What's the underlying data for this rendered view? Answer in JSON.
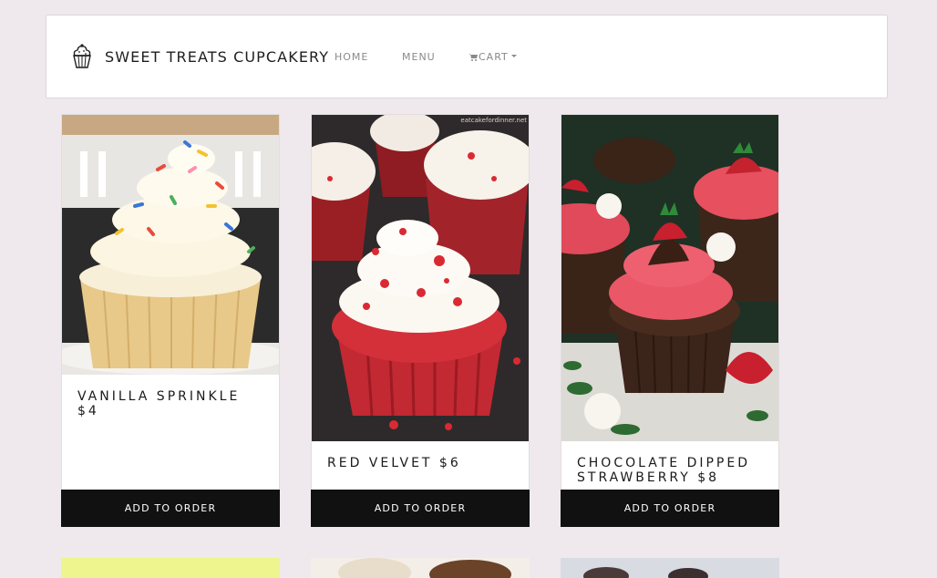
{
  "brand": {
    "name": "SWEET TREATS CUPCAKERY",
    "icon": "cupcake-logo-icon"
  },
  "nav": {
    "home": "HOME",
    "menu": "MENU",
    "cart": "CART",
    "cart_icon": "cart-icon"
  },
  "products": [
    {
      "title": "VANILLA SPRINKLE $4",
      "button": "ADD TO ORDER",
      "image_watermark": ""
    },
    {
      "title": "RED VELVET $6",
      "button": "ADD TO ORDER",
      "image_watermark": "eatcakefordinner.net"
    },
    {
      "title": "CHOCOLATE DIPPED STRAWBERRY $8",
      "button": "ADD TO ORDER",
      "image_watermark": ""
    }
  ],
  "colors": {
    "page_bg": "#efe9ed",
    "button_bg": "#111111",
    "button_text": "#ffffff"
  }
}
